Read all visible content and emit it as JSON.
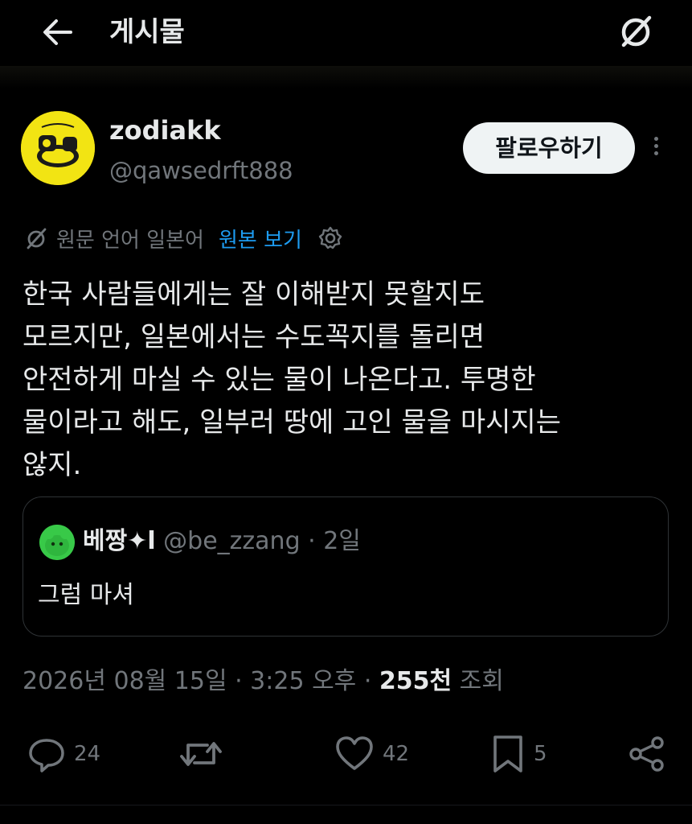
{
  "header": {
    "title": "게시물",
    "back_icon": "arrow-left-icon",
    "logo_icon": "grok-logo-icon"
  },
  "author": {
    "name": "zodiakk",
    "handle": "@qawsedrft888",
    "follow_label": "팔로우하기"
  },
  "translation": {
    "label": "원문 언어 일본어",
    "link": "원본 보기"
  },
  "tweet": {
    "lines": [
      "한국 사람들에게는 잘 이해받지 못할지도",
      "모르지만, 일본에서는 수도꼭지를 돌리면",
      "안전하게 마실 수 있는 물이 나온다고. 투명한",
      "물이라고 해도, 일부러 땅에 고인 물을 마시지는",
      "않지."
    ]
  },
  "quote": {
    "name": "베짱✦l",
    "handle": "@be_zzang · 2일",
    "text": "그럼 마셔"
  },
  "meta": {
    "datetime": "2026년 08월 15일 · 3:25 오후 · ",
    "views": "255천",
    "views_label": " 조회"
  },
  "actions": {
    "replies": "24",
    "retweets": "",
    "likes": "42",
    "bookmarks": "5"
  },
  "colors": {
    "background": "#000000",
    "text": "#e7e9ea",
    "muted": "#71767b",
    "link": "#1d9bf0",
    "follow_bg": "#eff3f4"
  }
}
